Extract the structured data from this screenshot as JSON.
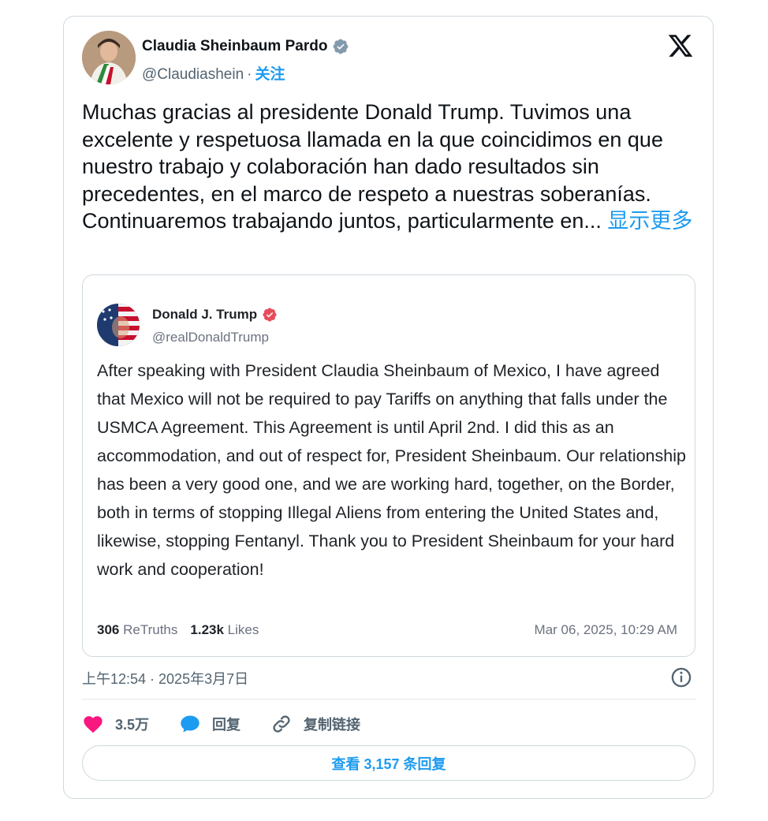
{
  "tweet": {
    "author_name": "Claudia Sheinbaum Pardo",
    "handle": "@Claudiashein",
    "separator": "·",
    "follow_label": "关注",
    "text": "Muchas gracias al presidente Donald Trump. Tuvimos una excelente y respetuosa llamada en la que coincidimos en que nuestro trabajo y colaboración han dado resultados sin precedentes, en el marco de respeto a nuestras soberanías. Continuaremos trabajando juntos, particularmente en...",
    "show_more": "显示更多",
    "timestamp": "上午12:54 · 2025年3月7日"
  },
  "quote": {
    "author_name": "Donald J. Trump",
    "handle": "@realDonaldTrump",
    "text": "After speaking with President Claudia Sheinbaum of Mexico, I have agreed that Mexico will not be required to pay Tariffs on anything that falls under the USMCA Agreement. This Agreement is until April 2nd. I did this as an accommodation, and out of respect for, President Sheinbaum. Our relationship has been a very good one, and we are working hard, together, on the Border, both in terms of stopping Illegal Aliens from entering the United States and, likewise, stopping Fentanyl. Thank you to President Sheinbaum for your hard work and cooperation!",
    "retruths_count": "306",
    "retruths_label": "ReTruths",
    "likes_count": "1.23k",
    "likes_label": "Likes",
    "date": "Mar 06, 2025, 10:29 AM"
  },
  "actions": {
    "like_count": "3.5万",
    "reply_label": "回复",
    "copy_link_label": "复制链接"
  },
  "replies_button": "查看 3,157 条回复",
  "colors": {
    "accent": "#1d9bf0",
    "like": "#f91880",
    "verified_blue": "#829aab",
    "truth_verified": "#e54d5c"
  },
  "icons": [
    "verified-badge-icon",
    "x-logo-icon",
    "info-icon",
    "heart-icon",
    "reply-bubble-icon",
    "link-icon"
  ]
}
